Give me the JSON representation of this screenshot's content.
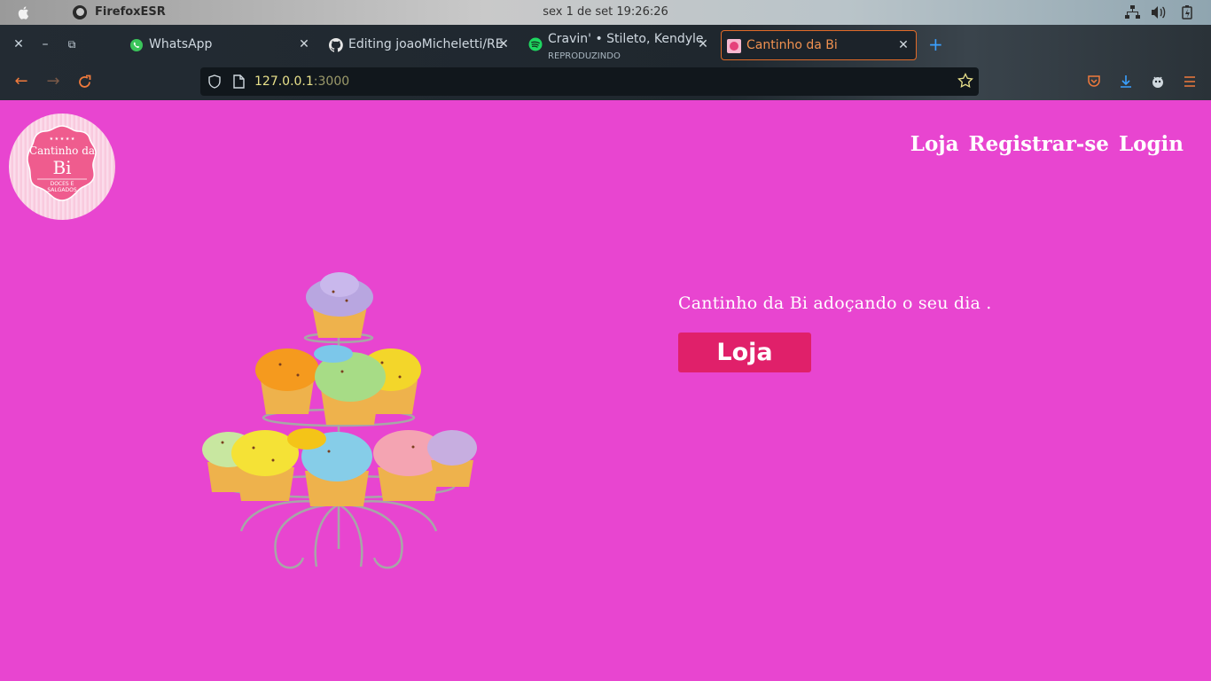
{
  "os_bar": {
    "app_name": "FirefoxESR",
    "clock": "sex 1 de set  19:26:26"
  },
  "browser": {
    "tabs": [
      {
        "title": "WhatsApp",
        "icon": "whatsapp-icon"
      },
      {
        "title": "Editing joaoMicheletti/RE",
        "icon": "github-icon"
      },
      {
        "title": "Cravin' • Stileto, Kendyle",
        "subtitle": "REPRODUZINDO",
        "icon": "spotify-icon"
      },
      {
        "title": "Cantinho da Bi",
        "icon": "site-favicon",
        "active": true
      }
    ],
    "url_host": "127.0.0.1",
    "url_port": ":3000",
    "colors": {
      "accent": "#e06a28",
      "url_text": "#e8e08a"
    }
  },
  "page": {
    "logo": {
      "line1": "Cantinho da",
      "line2": "Bi",
      "line3": "DOCES E",
      "line4": "SALGADOS"
    },
    "nav": [
      "Loja",
      "Registrar-se",
      "Login"
    ],
    "tagline": "Cantinho da Bi adoçando o seu dia .",
    "shop_button": "Loja",
    "colors": {
      "background": "#e845d0",
      "button": "#e0206a"
    }
  }
}
